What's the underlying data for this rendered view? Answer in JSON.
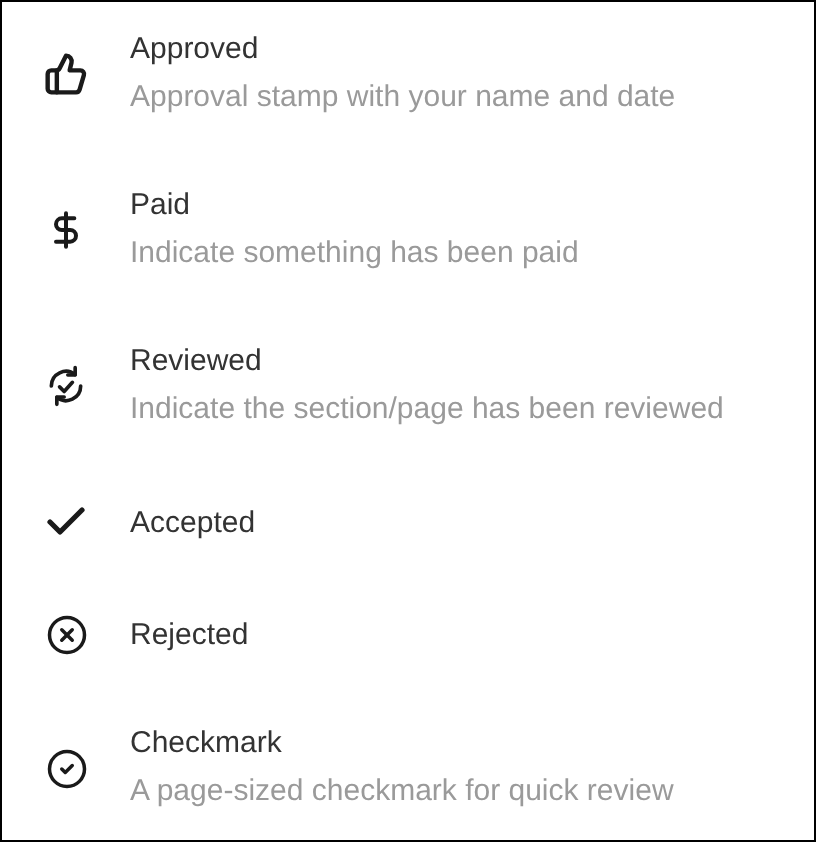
{
  "items": [
    {
      "kind": "approved",
      "title": "Approved",
      "description": "Approval stamp with your name and date"
    },
    {
      "kind": "paid",
      "title": "Paid",
      "description": "Indicate something has been paid"
    },
    {
      "kind": "reviewed",
      "title": "Reviewed",
      "description": "Indicate the section/page has been reviewed"
    },
    {
      "kind": "accepted",
      "title": "Accepted"
    },
    {
      "kind": "rejected",
      "title": "Rejected"
    },
    {
      "kind": "checkmark",
      "title": "Checkmark",
      "description": "A page-sized checkmark for quick review"
    }
  ]
}
